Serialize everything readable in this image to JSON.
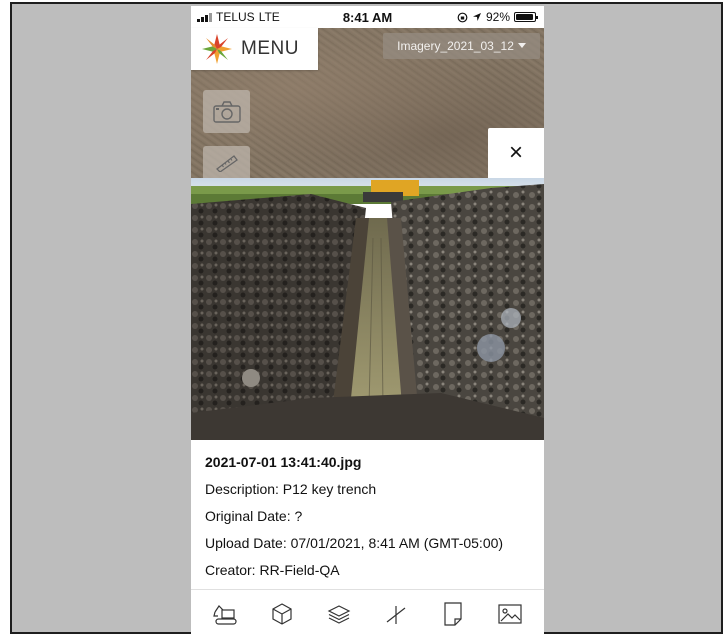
{
  "status_bar": {
    "carrier": "TELUS",
    "network": "LTE",
    "time": "8:41 AM",
    "battery": "92%",
    "battery_level": 0.92
  },
  "header": {
    "menu_label": "MENU",
    "imagery_selector": "Imagery_2021_03_12"
  },
  "tools": {
    "camera_icon": "camera-icon",
    "measure_icon": "ruler-icon"
  },
  "close_symbol": "×",
  "photo_details": {
    "filename": "2021-07-01 13:41:40.jpg",
    "description": "Description: P12 key trench",
    "original_date": "Original Date: ?",
    "upload_date": "Upload Date: 07/01/2021, 8:41 AM (GMT-05:00)",
    "creator": "Creator: RR-Field-QA"
  },
  "tab_bar": [
    {
      "icon": "excavator-icon"
    },
    {
      "icon": "cube-icon"
    },
    {
      "icon": "layers-icon"
    },
    {
      "icon": "measure-line-icon"
    },
    {
      "icon": "document-icon"
    },
    {
      "icon": "image-icon"
    }
  ],
  "colors": {
    "frame_background": "#bdbdbd",
    "logo_red": "#d9432a",
    "logo_orange": "#f0a030",
    "logo_green": "#6aa63a"
  }
}
